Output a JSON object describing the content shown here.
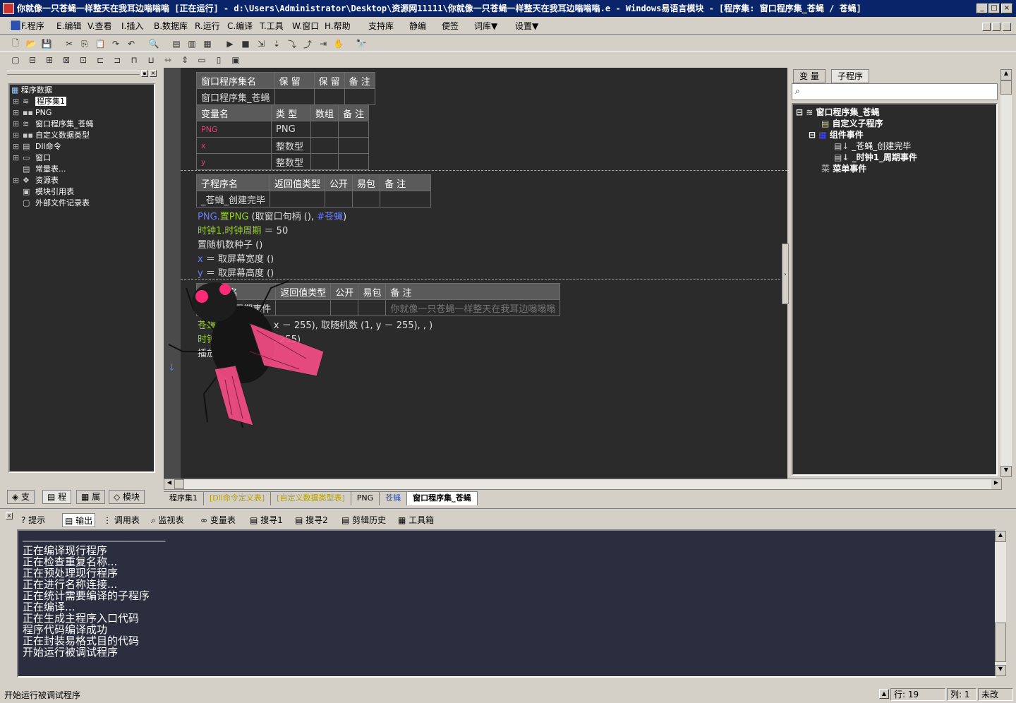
{
  "window": {
    "title": "你就像一只苍蝇一样整天在我耳边嗡嗡嗡 [正在运行] - d:\\Users\\Administrator\\Desktop\\资源网11111\\你就像一只苍蝇一样整天在我耳边嗡嗡嗡.e - Windows易语言模块 - [程序集: 窗口程序集_苍蝇 / 苍蝇]"
  },
  "menu": [
    {
      "label": "F.程序"
    },
    {
      "label": "E.编辑"
    },
    {
      "label": "V.查看"
    },
    {
      "label": "I.插入"
    },
    {
      "label": "B.数据库"
    },
    {
      "label": "R.运行"
    },
    {
      "label": "C.编译"
    },
    {
      "label": "T.工具"
    },
    {
      "label": "W.窗口"
    },
    {
      "label": "H.帮助"
    },
    {
      "label": "支持库"
    },
    {
      "label": "静编"
    },
    {
      "label": "便签"
    },
    {
      "label": "词库▼"
    },
    {
      "label": "设置▼"
    }
  ],
  "left_tree": {
    "root": "程序数据",
    "items": [
      "程序集1",
      "PNG",
      "窗口程序集_苍蝇",
      "自定义数据类型",
      "Dll命令",
      "窗口",
      "常量表...",
      "资源表",
      "模块引用表",
      "外部文件记录表"
    ]
  },
  "left_tabs": [
    "支",
    "程",
    "属",
    "模块"
  ],
  "assembly_table": {
    "headers": [
      "窗口程序集名",
      "保 留",
      "保 留",
      "备 注"
    ],
    "row": [
      "窗口程序集_苍蝇",
      "",
      "",
      ""
    ]
  },
  "var_table": {
    "headers": [
      "变量名",
      "类 型",
      "数组",
      "备 注"
    ],
    "rows": [
      [
        "PNG",
        "PNG",
        "",
        ""
      ],
      [
        "x",
        "整数型",
        "",
        ""
      ],
      [
        "y",
        "整数型",
        "",
        ""
      ]
    ]
  },
  "sub1_table": {
    "headers": [
      "子程序名",
      "返回值类型",
      "公开",
      "易包",
      "备 注"
    ],
    "row": [
      "_苍蝇_创建完毕",
      "",
      "",
      "",
      ""
    ]
  },
  "sub1_code": [
    {
      "a": "PNG.",
      "b": "置PNG",
      "c": " (取窗口句柄 (), ",
      "d": "#苍蝇",
      "e": ")"
    },
    {
      "a": "时钟1.",
      "b": "时钟周期",
      "c": " ＝ 50"
    },
    {
      "a": "",
      "b": "",
      "c": "置随机数种子 ()"
    },
    {
      "a": "x",
      "b": "",
      "c": " ＝ 取屏幕宽度 ()"
    },
    {
      "a": "y",
      "b": "",
      "c": " ＝ 取屏幕高度 ()"
    }
  ],
  "sub2_table": {
    "headers": [
      "子程序名",
      "返回值类型",
      "公开",
      "易包",
      "备 注"
    ],
    "row": [
      "_时钟1_周期事件",
      "",
      "",
      "",
      "你就像一只苍蝇一样整天在我耳边嗡嗡嗡"
    ]
  },
  "sub2_code": [
    {
      "a": "苍蝇",
      "c": " 取随机数 (1, x － 255), 取随机数 (1, y － 255), , )"
    },
    {
      "a": "时钟",
      "c": " 取随机数 (10, 255)"
    },
    {
      "a": "",
      "c": "播放"
    }
  ],
  "right_tabs": [
    "变 量",
    "子程序"
  ],
  "search_icon": "magnifier-icon",
  "right_tree": {
    "root": "窗口程序集_苍蝇",
    "custom": "自定义子程序",
    "events": "组件事件",
    "event_items": [
      "_苍蝇_创建完毕",
      "_时钟1_周期事件"
    ],
    "menu_events": "菜单事件",
    "menu_prefix": "菜"
  },
  "doc_tabs": [
    "程序集1",
    "[Dll命令定义表]",
    "[自定义数据类型表]",
    "PNG",
    "苍蝇",
    "窗口程序集_苍蝇"
  ],
  "bottom_tabs": [
    "提示",
    "输出",
    "调用表",
    "监视表",
    "变量表",
    "搜寻1",
    "搜寻2",
    "剪辑历史",
    "工具箱"
  ],
  "output": {
    "separator": "────────────────────────────",
    "lines": [
      "正在编译现行程序",
      "正在检查重复名称...",
      "正在预处理现行程序",
      "正在进行名称连接...",
      "正在统计需要编译的子程序",
      "正在编译...",
      "正在生成主程序入口代码",
      "程序代码编译成功",
      "正在封装易格式目的代码",
      "开始运行被调试程序"
    ]
  },
  "status": {
    "message": "开始运行被调试程序",
    "line": "行: 19",
    "col": "列: 1",
    "modified": "未改"
  },
  "colors": {
    "editor_bg": "#2b2b2b",
    "title_bg": "#0a246a",
    "keyword_green": "#9acd32",
    "var_red": "#e0407a",
    "var_blue": "#6a7cff",
    "fly_pink": "#ff4f8b"
  }
}
